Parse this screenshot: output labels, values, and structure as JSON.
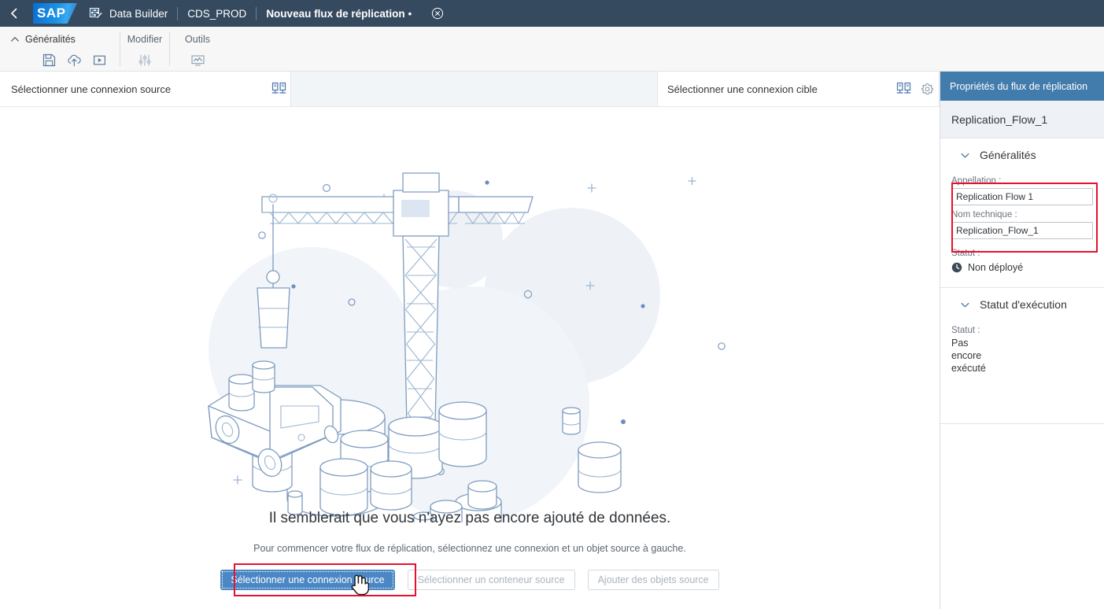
{
  "shellbar": {
    "back_icon": "chevron-left-icon",
    "logo_text": "SAP",
    "breadcrumbs": [
      {
        "label": "Data Builder",
        "icon": "data-builder-icon"
      },
      {
        "label": "CDS_PROD"
      },
      {
        "label": "Nouveau flux de réplication",
        "dirty": "•"
      }
    ],
    "close_icon": "close-circle-icon"
  },
  "toolbar": {
    "groups": [
      {
        "title": "Généralités",
        "collapse_icon": "chevron-up-icon",
        "buttons": [
          {
            "name": "save-button",
            "icon": "save-icon"
          },
          {
            "name": "deploy-button",
            "icon": "cloud-upload-icon"
          },
          {
            "name": "run-button",
            "icon": "play-box-icon"
          }
        ]
      },
      {
        "title": "Modifier",
        "buttons": [
          {
            "name": "settings-button",
            "icon": "sliders-icon"
          }
        ]
      },
      {
        "title": "Outils",
        "buttons": [
          {
            "name": "impact-analysis-button",
            "icon": "monitor-chart-icon"
          }
        ]
      }
    ]
  },
  "panels": {
    "source": {
      "label": "Sélectionner une connexion source",
      "connection_icon": "connection-icon"
    },
    "target": {
      "label": "Sélectionner une connexion cible",
      "connection_icon": "connection-icon",
      "settings_icon": "gear-icon"
    }
  },
  "canvas": {
    "empty_title": "Il semblerait que vous n'ayez pas encore ajouté de données.",
    "empty_subtitle": "Pour commencer votre flux de réplication, sélectionnez une connexion et un objet source à gauche.",
    "actions": [
      {
        "label": "Sélectionner une connexion source",
        "state": "primary"
      },
      {
        "label": "Sélectionner un conteneur source",
        "state": "disabled"
      },
      {
        "label": "Ajouter des objets source",
        "state": "disabled"
      }
    ],
    "cursor": "hand-pointer-cursor"
  },
  "properties": {
    "header": "Propriétés du flux de réplication",
    "object_name": "Replication_Flow_1",
    "general_section": {
      "title": "Généralités",
      "chevron": "chevron-down-icon",
      "name_label": "Appellation :",
      "name_value": "Replication Flow 1",
      "technical_name_label": "Nom technique :",
      "technical_name_value": "Replication_Flow_1",
      "status_label": "Statut :",
      "status_value": "Non déployé",
      "status_icon": "clock-icon"
    },
    "execution_section": {
      "title": "Statut d'exécution",
      "chevron": "chevron-down-icon",
      "status_label": "Statut :",
      "status_value": "Pas encore exécuté"
    }
  },
  "colors": {
    "shellbar": "#354a5f",
    "accent_blue": "#427cac",
    "primary_button": "#4a87c4",
    "highlight_red": "#e8112d",
    "illustration_line": "#7e9cc0"
  }
}
